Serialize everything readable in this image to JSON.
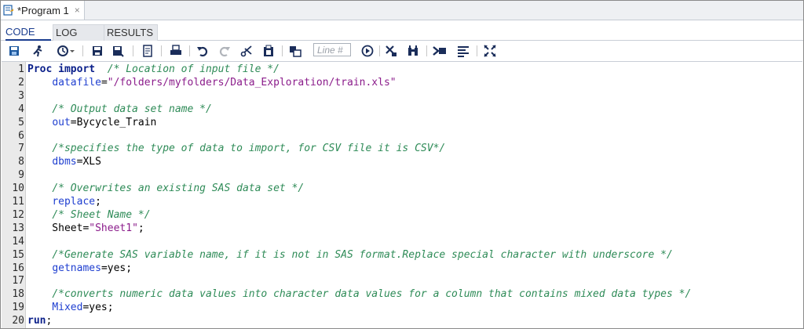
{
  "program_tab": {
    "title": "*Program 1",
    "close": "×"
  },
  "subtabs": {
    "code": "CODE",
    "log": "LOG",
    "results": "RESULTS"
  },
  "toolbar": {
    "line_placeholder": "Line #"
  },
  "colors": {
    "keyword": "#0a1f8a",
    "comment": "#2e8b57",
    "option": "#1f3fd0",
    "string": "#8b1c8b"
  },
  "editor": {
    "lines": [
      {
        "n": "1",
        "segs": [
          [
            "kw",
            "Proc import"
          ],
          [
            "",
            "  "
          ],
          [
            "cm",
            "/* Location of input file */"
          ]
        ]
      },
      {
        "n": "2",
        "segs": [
          [
            "",
            "    "
          ],
          [
            "opt",
            "datafile"
          ],
          [
            "",
            "="
          ],
          [
            "str",
            "\"/folders/myfolders/Data_Exploration/train.xls\""
          ]
        ]
      },
      {
        "n": "3",
        "segs": []
      },
      {
        "n": "4",
        "segs": [
          [
            "",
            "    "
          ],
          [
            "cm",
            "/* Output data set name */"
          ]
        ]
      },
      {
        "n": "5",
        "segs": [
          [
            "",
            "    "
          ],
          [
            "opt",
            "out"
          ],
          [
            "",
            "=Bycycle_Train"
          ]
        ]
      },
      {
        "n": "6",
        "segs": []
      },
      {
        "n": "7",
        "segs": [
          [
            "",
            "    "
          ],
          [
            "cm",
            "/*specifies the type of data to import, for CSV file it is CSV*/"
          ]
        ]
      },
      {
        "n": "8",
        "segs": [
          [
            "",
            "    "
          ],
          [
            "opt",
            "dbms"
          ],
          [
            "",
            "=XLS"
          ]
        ]
      },
      {
        "n": "9",
        "segs": []
      },
      {
        "n": "10",
        "segs": [
          [
            "",
            "    "
          ],
          [
            "cm",
            "/* Overwrites an existing SAS data set */"
          ]
        ]
      },
      {
        "n": "11",
        "segs": [
          [
            "",
            "    "
          ],
          [
            "opt",
            "replace"
          ],
          [
            "",
            ";"
          ]
        ]
      },
      {
        "n": "12",
        "segs": [
          [
            "",
            "    "
          ],
          [
            "cm",
            "/* Sheet Name */"
          ]
        ]
      },
      {
        "n": "13",
        "segs": [
          [
            "",
            "    Sheet="
          ],
          [
            "str",
            "\"Sheet1\""
          ],
          [
            "",
            ";"
          ]
        ]
      },
      {
        "n": "14",
        "segs": []
      },
      {
        "n": "15",
        "segs": [
          [
            "",
            "    "
          ],
          [
            "cm",
            "/*Generate SAS variable name, if it is not in SAS format.Replace special character with underscore */"
          ]
        ]
      },
      {
        "n": "16",
        "segs": [
          [
            "",
            "    "
          ],
          [
            "opt",
            "getnames"
          ],
          [
            "",
            "=yes;"
          ]
        ]
      },
      {
        "n": "17",
        "segs": []
      },
      {
        "n": "18",
        "segs": [
          [
            "",
            "    "
          ],
          [
            "cm",
            "/*converts numeric data values into character data values for a column that contains mixed data types */"
          ]
        ]
      },
      {
        "n": "19",
        "segs": [
          [
            "",
            "    "
          ],
          [
            "opt",
            "Mixed"
          ],
          [
            "",
            "=yes;"
          ]
        ]
      },
      {
        "n": "20",
        "segs": [
          [
            "kw",
            "run"
          ],
          [
            "",
            ";"
          ]
        ]
      }
    ]
  }
}
